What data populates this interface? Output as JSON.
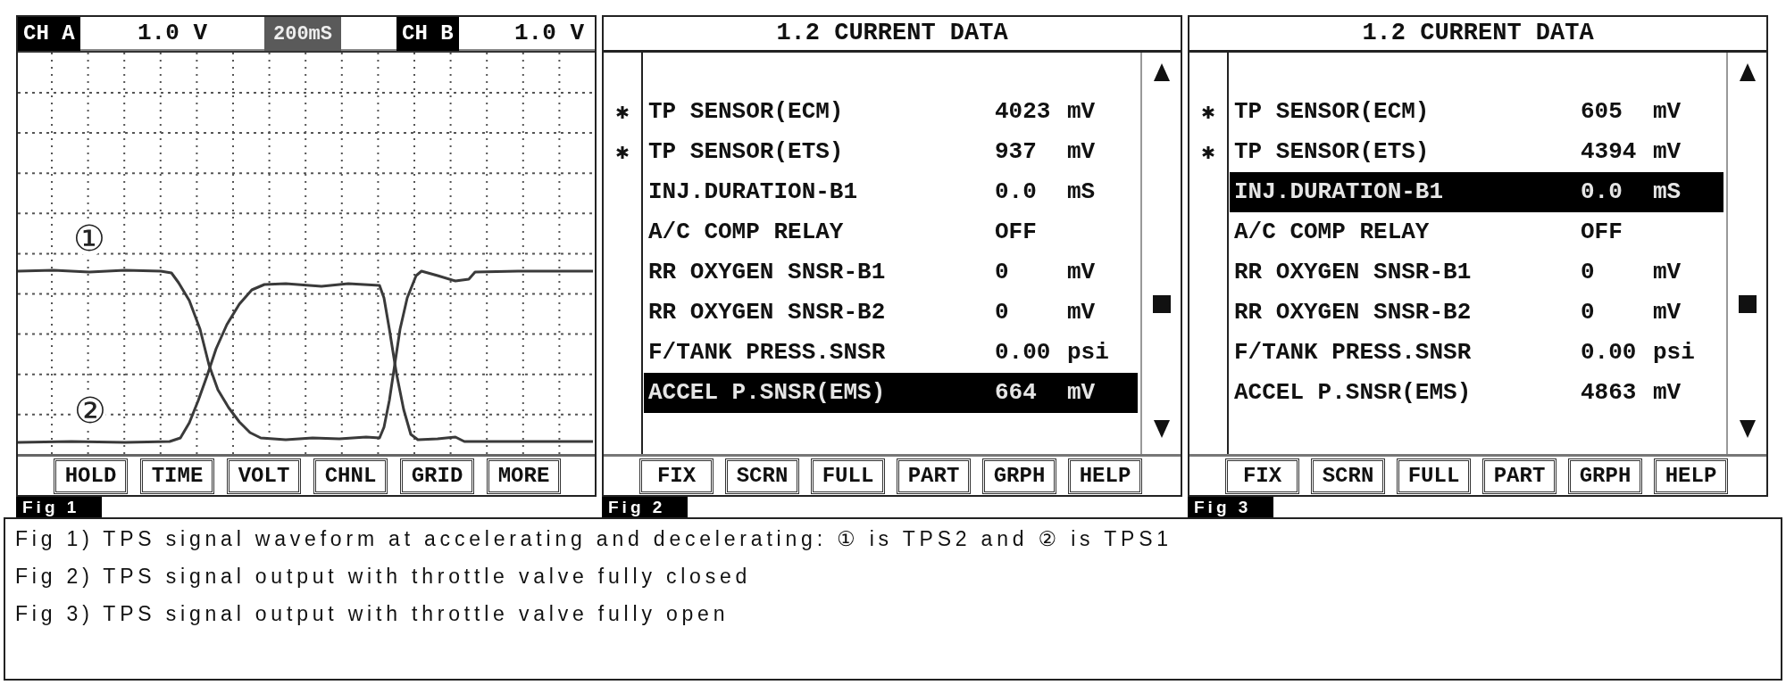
{
  "figures": [
    {
      "kind": "scope",
      "label": "Fig 1",
      "header": [
        {
          "kind": "channel",
          "text": "CH A"
        },
        {
          "kind": "scale",
          "text": "1.0 V"
        },
        {
          "kind": "timebase",
          "text": "200mS"
        },
        {
          "kind": "channel",
          "text": "CH B"
        },
        {
          "kind": "scale",
          "text": "1.0 V"
        }
      ],
      "traces": [
        {
          "label": "①"
        },
        {
          "label": "②"
        }
      ],
      "buttons": [
        "HOLD",
        "TIME",
        "VOLT",
        "CHNL",
        "GRID",
        "MORE"
      ]
    },
    {
      "kind": "data_list",
      "label": "Fig 2",
      "title": "1.2 CURRENT DATA",
      "rows": [
        {
          "marked": true,
          "name": "TP SENSOR(ECM)",
          "value": "4023",
          "unit": "mV",
          "selected": false
        },
        {
          "marked": true,
          "name": "TP SENSOR(ETS)",
          "value": "937",
          "unit": "mV",
          "selected": false
        },
        {
          "marked": false,
          "name": "INJ.DURATION-B1",
          "value": "0.0",
          "unit": "mS",
          "selected": false
        },
        {
          "marked": false,
          "name": "A/C COMP RELAY",
          "value": "OFF",
          "selected": false
        },
        {
          "marked": false,
          "name": "RR OXYGEN SNSR-B1",
          "value": "0",
          "unit": "mV",
          "selected": false
        },
        {
          "marked": false,
          "name": "RR OXYGEN SNSR-B2",
          "value": "0",
          "unit": "mV",
          "selected": false
        },
        {
          "marked": false,
          "name": "F/TANK PRESS.SNSR",
          "value": "0.00",
          "unit": "psi",
          "selected": false
        },
        {
          "marked": false,
          "name": "ACCEL P.SNSR(EMS)",
          "value": "664",
          "unit": "mV",
          "selected": true
        }
      ],
      "buttons": [
        "FIX",
        "SCRN",
        "FULL",
        "PART",
        "GRPH",
        "HELP"
      ]
    },
    {
      "kind": "data_list",
      "label": "Fig 3",
      "title": "1.2 CURRENT DATA",
      "rows": [
        {
          "marked": true,
          "name": "TP SENSOR(ECM)",
          "value": "605",
          "unit": "mV",
          "selected": false
        },
        {
          "marked": true,
          "name": "TP SENSOR(ETS)",
          "value": "4394",
          "unit": "mV",
          "selected": false
        },
        {
          "marked": false,
          "name": "INJ.DURATION-B1",
          "value": "0.0",
          "unit": "mS",
          "selected": true
        },
        {
          "marked": false,
          "name": "A/C COMP RELAY",
          "value": "OFF",
          "selected": false
        },
        {
          "marked": false,
          "name": "RR OXYGEN SNSR-B1",
          "value": "0",
          "unit": "mV",
          "selected": false
        },
        {
          "marked": false,
          "name": "RR OXYGEN SNSR-B2",
          "value": "0",
          "unit": "mV",
          "selected": false
        },
        {
          "marked": false,
          "name": "F/TANK PRESS.SNSR",
          "value": "0.00",
          "unit": "psi",
          "selected": false
        },
        {
          "marked": false,
          "name": "ACCEL P.SNSR(EMS)",
          "value": "4863",
          "unit": "mV",
          "selected": false
        }
      ],
      "buttons": [
        "FIX",
        "SCRN",
        "FULL",
        "PART",
        "GRPH",
        "HELP"
      ]
    }
  ],
  "captions": [
    "Fig 1) TPS signal waveform at accelerating and decelerating: ① is TPS2 and ② is TPS1",
    "Fig 2) TPS signal output with throttle valve fully closed",
    "Fig 3) TPS signal output with throttle valve fully open"
  ]
}
